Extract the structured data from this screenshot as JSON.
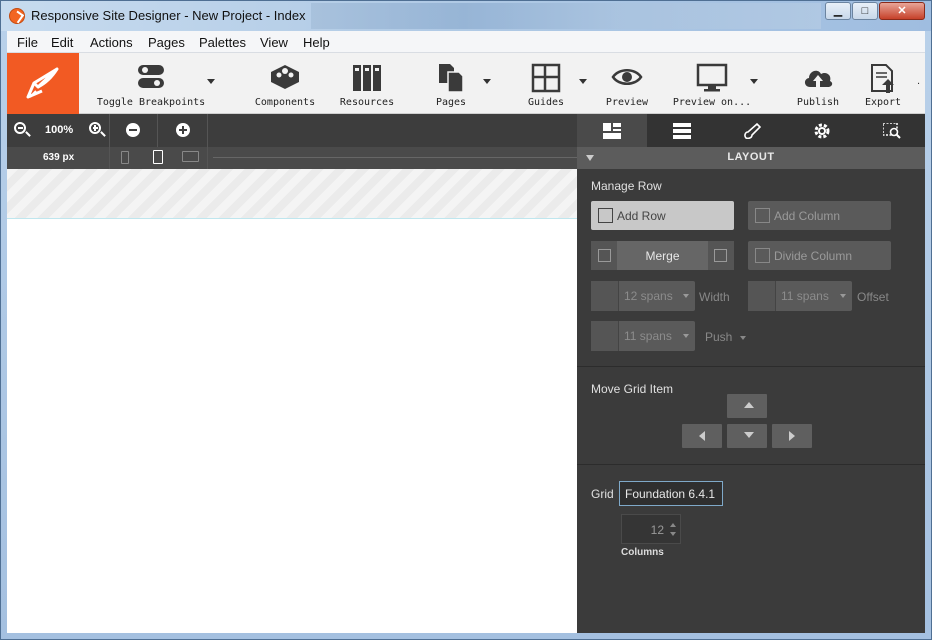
{
  "window": {
    "title": "Responsive Site Designer - New Project - Index",
    "controls": {
      "minimize": "▁",
      "maximize": "□",
      "close": "✕"
    }
  },
  "menu": [
    "File",
    "Edit",
    "Actions",
    "Pages",
    "Palettes",
    "View",
    "Help"
  ],
  "toolbar": {
    "toggle_breakpoints": "Toggle Breakpoints",
    "components": "Components",
    "resources": "Resources",
    "pages": "Pages",
    "guides": "Guides",
    "preview": "Preview",
    "preview_on": "Preview on...",
    "publish": "Publish",
    "export": "Export",
    "overflow": "."
  },
  "canvas": {
    "zoom": "100%",
    "width_label": "639 px"
  },
  "panel": {
    "header": "LAYOUT",
    "manage_row": "Manage Row",
    "add_row": "Add Row",
    "add_column": "Add Column",
    "merge": "Merge",
    "divide_column": "Divide Column",
    "width_value": "12 spans",
    "width_label": "Width",
    "offset_value": "11 spans",
    "offset_label": "Offset",
    "push_value": "11 spans",
    "push_label": "Push",
    "move_grid_item": "Move Grid Item",
    "grid_label": "Grid",
    "grid_value": "Foundation 6.4.1",
    "columns_value": "12",
    "columns_label": "Columns"
  },
  "colors": {
    "brand": "#f25a23",
    "panel_bg": "#3b3b3b",
    "canvas_bg": "#ffffff"
  }
}
